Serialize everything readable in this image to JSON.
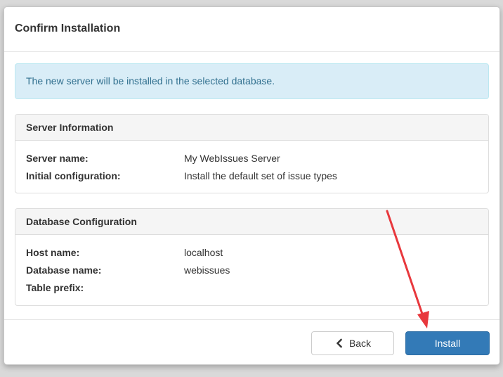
{
  "dialog": {
    "title": "Confirm Installation"
  },
  "alert": {
    "text": "The new server will be installed in the selected database."
  },
  "server_info": {
    "heading": "Server Information",
    "rows": [
      {
        "label": "Server name:",
        "value": "My WebIssues Server"
      },
      {
        "label": "Initial configuration:",
        "value": "Install the default set of issue types"
      }
    ]
  },
  "database_config": {
    "heading": "Database Configuration",
    "rows": [
      {
        "label": "Host name:",
        "value": "localhost"
      },
      {
        "label": "Database name:",
        "value": "webissues"
      },
      {
        "label": "Table prefix:",
        "value": ""
      }
    ]
  },
  "footer": {
    "back_label": "Back",
    "back_icon": "chevron-left-icon",
    "install_label": "Install"
  },
  "colors": {
    "primary": "#337ab7",
    "alert_bg": "#d9edf7",
    "alert_text": "#31708f",
    "annotation_arrow": "#e8383d"
  }
}
